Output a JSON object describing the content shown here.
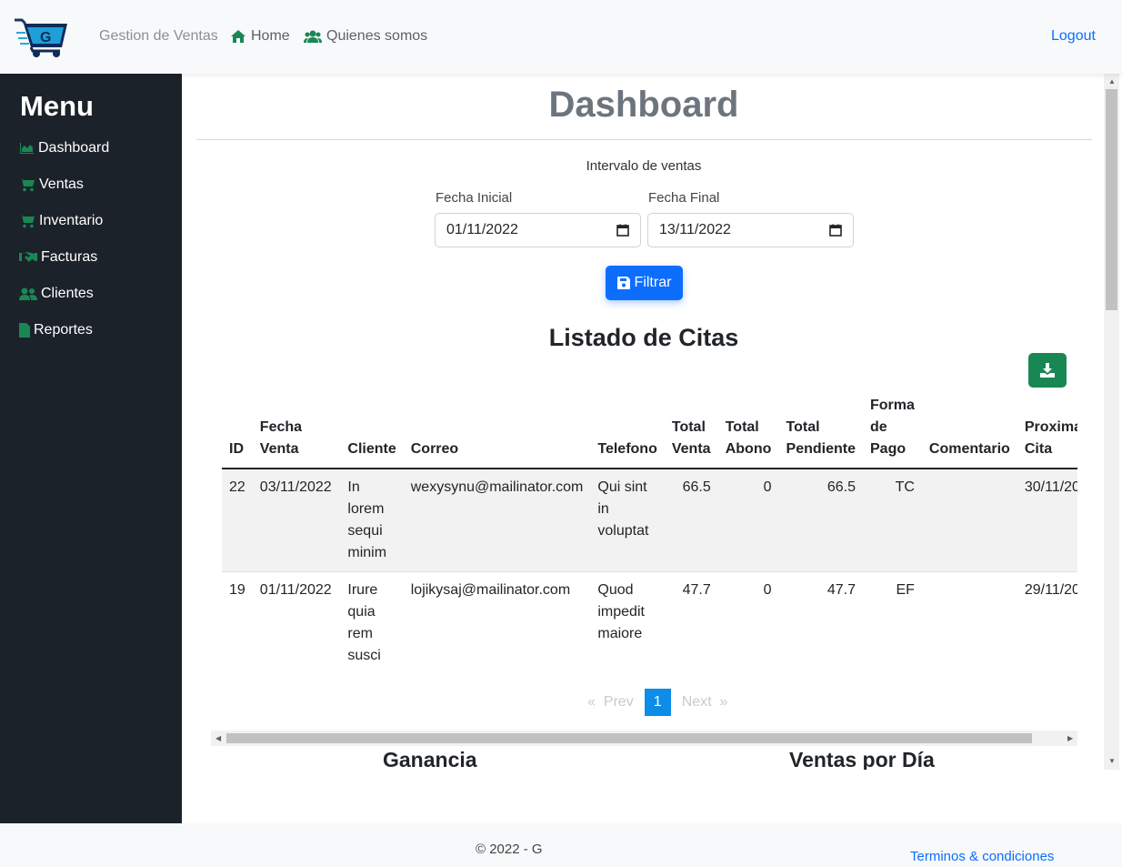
{
  "navbar": {
    "brand": "Gestion de Ventas",
    "home": "Home",
    "about": "Quienes somos",
    "logout": "Logout",
    "logo_letter": "G"
  },
  "sidebar": {
    "title": "Menu",
    "items": [
      {
        "label": "Dashboard",
        "icon": "chart-area-icon"
      },
      {
        "label": "Ventas",
        "icon": "cart-icon"
      },
      {
        "label": "Inventario",
        "icon": "cart-icon"
      },
      {
        "label": "Facturas",
        "icon": "handshake-icon"
      },
      {
        "label": "Clientes",
        "icon": "users-icon"
      },
      {
        "label": "Reportes",
        "icon": "file-icon"
      }
    ]
  },
  "main": {
    "title": "Dashboard",
    "interval_label": "Intervalo de ventas",
    "start_label": "Fecha Inicial",
    "start_value": "01/11/2022",
    "end_label": "Fecha Final",
    "end_value": "13/11/2022",
    "filter_button": "Filtrar",
    "list_title": "Listado de Citas",
    "chart1_title": "Ganancia",
    "chart2_title": "Ventas por Día"
  },
  "table": {
    "headers": {
      "id": "ID",
      "fecha_venta": "Fecha Venta",
      "cliente": "Cliente",
      "correo": "Correo",
      "telefono": "Telefono",
      "total_venta": "Total Venta",
      "total_abono": "Total Abono",
      "total_pendiente": "Total Pendiente",
      "forma_pago": "Forma de Pago",
      "comentario": "Comentario",
      "proxima_cita": "Proxima Cita"
    },
    "rows": [
      {
        "id": "22",
        "fecha_venta": "03/11/2022",
        "cliente": "In lorem sequi minim",
        "correo": "wexysynu@mailinator.com",
        "telefono": "Qui sint in voluptat",
        "total_venta": "66.5",
        "total_abono": "0",
        "total_pendiente": "66.5",
        "forma_pago": "TC",
        "comentario": "",
        "proxima_cita": "30/11/20"
      },
      {
        "id": "19",
        "fecha_venta": "01/11/2022",
        "cliente": "Irure quia rem susci",
        "correo": "lojikysaj@mailinator.com",
        "telefono": "Quod impedit maiore",
        "total_venta": "47.7",
        "total_abono": "0",
        "total_pendiente": "47.7",
        "forma_pago": "EF",
        "comentario": "",
        "proxima_cita": "29/11/20"
      }
    ]
  },
  "pagination": {
    "prev_arrow": "«",
    "prev": "Prev",
    "current": "1",
    "next": "Next",
    "next_arrow": "»"
  },
  "footer": {
    "copyright": "© 2022 - G",
    "terms": "Terminos & condiciones"
  },
  "colors": {
    "sidebar_bg": "#1c2229",
    "accent_green": "#198754",
    "primary_blue": "#0d6efd",
    "page_active": "#0d8ce8"
  }
}
